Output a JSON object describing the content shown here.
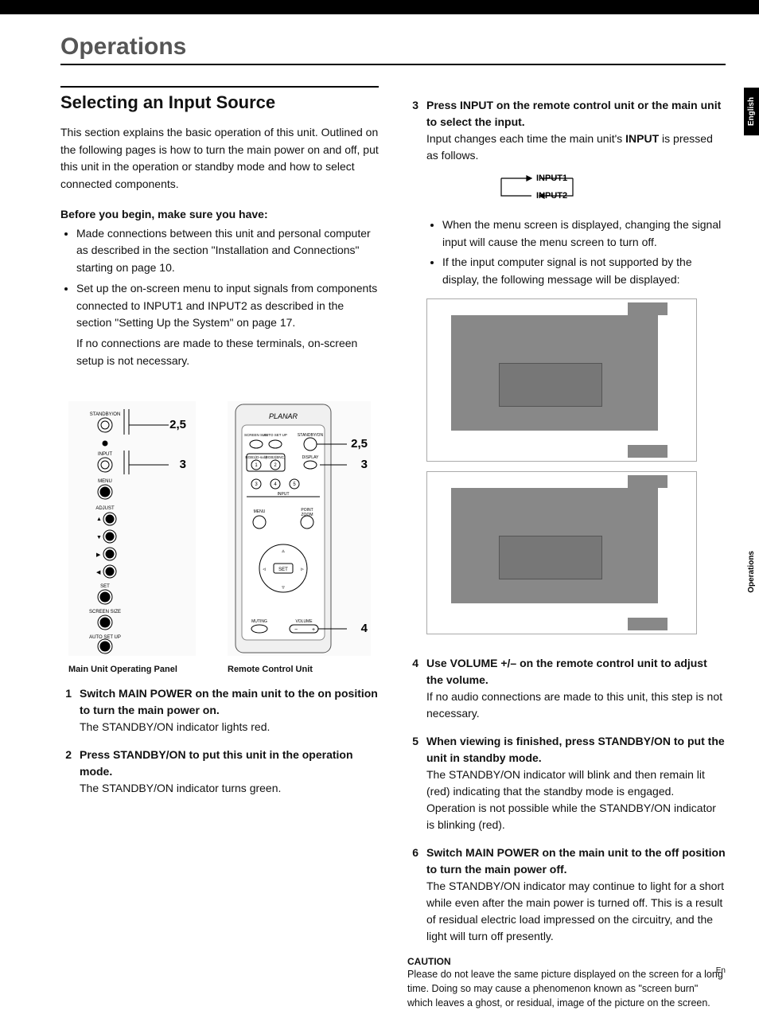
{
  "top": {
    "heading": "Operations"
  },
  "section": {
    "rule_present": true,
    "heading": "Selecting an Input Source",
    "intro": "This section explains the basic operation of this unit. Outlined on the following pages is how to turn the main power on and off, put this unit in the operation or standby mode and how to select connected components.",
    "before_heading": "Before you begin, make sure you have:",
    "bullets": [
      "Made connections between this unit and personal computer as described in the section \"Installation and Connections\" starting on page 10.",
      "Set up the on-screen menu to input signals from components connected to INPUT1 and INPUT2 as described in the section \"Setting Up the System\" on page 17."
    ],
    "bullet2_followup": "If no connections are made to these terminals, on-screen setup is not necessary."
  },
  "illus": {
    "panel_caption": "Main Unit Operating Panel",
    "remote_caption": "Remote Control Unit",
    "callouts_panel": {
      "a": "2,5",
      "b": "3"
    },
    "callouts_remote": {
      "a": "2,5",
      "b": "3",
      "c": "4"
    }
  },
  "steps_left": [
    {
      "n": "1",
      "lead": "Switch MAIN POWER on the main unit to the on position to turn the main power on.",
      "follow": "The STANDBY/ON indicator lights red."
    },
    {
      "n": "2",
      "lead": "Press STANDBY/ON to put this unit in the operation mode.",
      "follow": "The STANDBY/ON indicator turns green."
    }
  ],
  "step3": {
    "n": "3",
    "lead": "Press INPUT on the remote control unit or the main unit to select the input.",
    "follow_pre": "Input changes each time the main unit's ",
    "follow_bold": "INPUT",
    "follow_post": " is pressed as follows.",
    "flow": {
      "a": "INPUT1",
      "b": "INPUT2"
    },
    "notes": [
      "When the menu screen is displayed, changing the signal input will cause the menu screen to turn off.",
      "If the input computer signal is not supported by the display, the following message will be displayed:"
    ]
  },
  "steps_right": [
    {
      "n": "4",
      "lead": "Use VOLUME +/– on the remote control unit to adjust the volume.",
      "follow": "If no audio connections are made to this unit, this step is not necessary."
    },
    {
      "n": "5",
      "lead": "When viewing is finished, press STANDBY/ON to put the unit in standby mode.",
      "follow": "The STANDBY/ON indicator will blink and then remain lit (red) indicating that the standby mode is engaged. Operation is not possible while the STANDBY/ON indicator is blinking (red)."
    },
    {
      "n": "6",
      "lead": "Switch MAIN POWER on the main unit to the off position to turn the main power off.",
      "follow": "The STANDBY/ON indicator may continue to light for a short while even after the main power is turned off. This is a result of residual electric load impressed on the circuitry, and the light will turn off presently."
    }
  ],
  "caution": {
    "head": "CAUTION",
    "body": "Please do not leave the same picture displayed on the screen for a long time. Doing so may cause a phenomenon known as \"screen burn\" which leaves a ghost, or residual, image of the picture on the screen."
  },
  "tabs": {
    "lang": "English",
    "section": "Operations"
  },
  "foot": "En"
}
